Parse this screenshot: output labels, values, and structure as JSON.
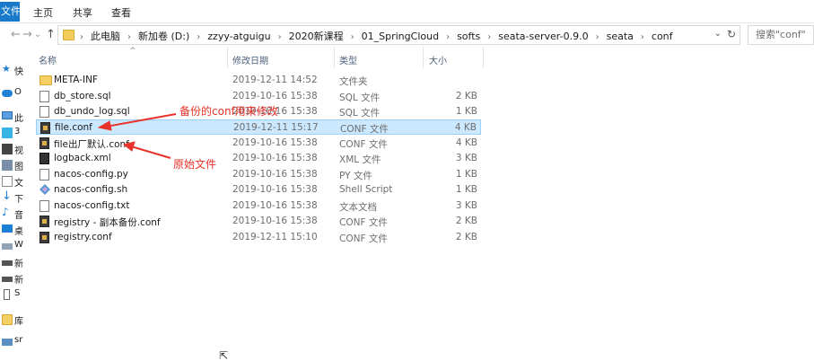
{
  "ribbon": {
    "file_tab": "文件",
    "tabs": [
      "主页",
      "共享",
      "查看"
    ]
  },
  "nav": {
    "back": "←",
    "forward": "→",
    "recent": "⌄",
    "up": "↑",
    "breadcrumb": [
      "此电脑",
      "新加卷 (D:)",
      "zzyy-atguigu",
      "2020新课程",
      "01_SpringCloud",
      "softs",
      "seata-server-0.9.0",
      "seata",
      "conf"
    ],
    "search_placeholder": "搜索\"conf\""
  },
  "sidebar": {
    "items": [
      {
        "label": "快",
        "icon": "star-icon"
      },
      {
        "label": "O",
        "icon": "cloud-icon"
      },
      {
        "label": "此",
        "icon": "computer-icon"
      },
      {
        "label": "3",
        "icon": "cube-icon"
      },
      {
        "label": "视",
        "icon": "video-icon"
      },
      {
        "label": "图",
        "icon": "picture-icon"
      },
      {
        "label": "文",
        "icon": "document-icon"
      },
      {
        "label": "下",
        "icon": "download-icon"
      },
      {
        "label": "音",
        "icon": "music-icon"
      },
      {
        "label": "桌",
        "icon": "desktop-icon"
      },
      {
        "label": "W",
        "icon": "drive-icon"
      },
      {
        "label": "新",
        "icon": "drive-icon"
      },
      {
        "label": "新",
        "icon": "drive-icon"
      },
      {
        "label": "S",
        "icon": "drive-icon"
      },
      {
        "label": "库",
        "icon": "library-icon"
      },
      {
        "label": "sr",
        "icon": "network-icon"
      }
    ]
  },
  "columns": {
    "name": "名称",
    "date": "修改日期",
    "type": "类型",
    "size": "大小"
  },
  "files": [
    {
      "name": "META-INF",
      "date": "2019-12-11 14:52",
      "type": "文件夹",
      "size": "",
      "icon": "folder-icon"
    },
    {
      "name": "db_store.sql",
      "date": "2019-10-16 15:38",
      "type": "SQL 文件",
      "size": "2 KB",
      "icon": "file-icon"
    },
    {
      "name": "db_undo_log.sql",
      "date": "2019-10-16 15:38",
      "type": "SQL 文件",
      "size": "1 KB",
      "icon": "file-icon"
    },
    {
      "name": "file.conf",
      "date": "2019-12-11 15:17",
      "type": "CONF 文件",
      "size": "4 KB",
      "icon": "config-file-icon"
    },
    {
      "name": "file出厂默认.conf",
      "date": "2019-10-16 15:38",
      "type": "CONF 文件",
      "size": "4 KB",
      "icon": "config-file-icon"
    },
    {
      "name": "logback.xml",
      "date": "2019-10-16 15:38",
      "type": "XML 文件",
      "size": "3 KB",
      "icon": "xml-file-icon"
    },
    {
      "name": "nacos-config.py",
      "date": "2019-10-16 15:38",
      "type": "PY 文件",
      "size": "1 KB",
      "icon": "file-icon"
    },
    {
      "name": "nacos-config.sh",
      "date": "2019-10-16 15:38",
      "type": "Shell Script",
      "size": "1 KB",
      "icon": "shell-script-icon"
    },
    {
      "name": "nacos-config.txt",
      "date": "2019-10-16 15:38",
      "type": "文本文档",
      "size": "3 KB",
      "icon": "file-icon"
    },
    {
      "name": "registry - 副本备份.conf",
      "date": "2019-10-16 15:38",
      "type": "CONF 文件",
      "size": "2 KB",
      "icon": "config-file-icon"
    },
    {
      "name": "registry.conf",
      "date": "2019-12-11 15:10",
      "type": "CONF 文件",
      "size": "2 KB",
      "icon": "config-file-icon"
    }
  ],
  "selected_file": "file.conf",
  "annotations": {
    "backup_note": "备份的conf用来修改",
    "original_note": "原始文件",
    "color": "#e8322a"
  },
  "colors": {
    "selection_bg": "#cce8ff",
    "selection_border": "#99d1ff",
    "file_tab": "#1979ca"
  }
}
